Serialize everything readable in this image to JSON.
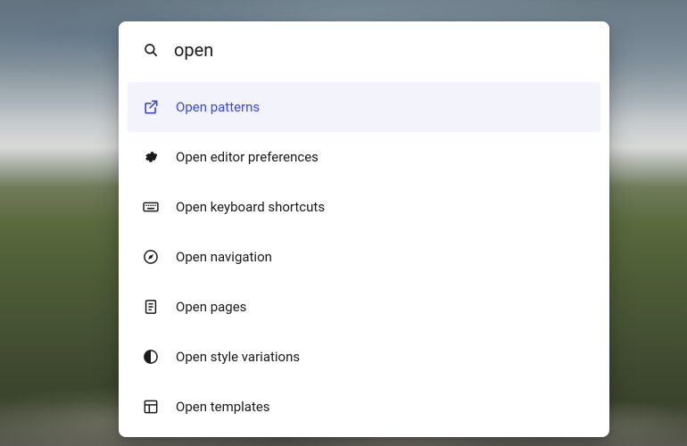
{
  "search": {
    "value": "open"
  },
  "results": [
    {
      "icon": "external-link-icon",
      "label": "Open patterns",
      "selected": true
    },
    {
      "icon": "gear-icon",
      "label": "Open editor preferences",
      "selected": false
    },
    {
      "icon": "keyboard-icon",
      "label": "Open keyboard shortcuts",
      "selected": false
    },
    {
      "icon": "compass-icon",
      "label": "Open navigation",
      "selected": false
    },
    {
      "icon": "page-icon",
      "label": "Open pages",
      "selected": false
    },
    {
      "icon": "half-circle-icon",
      "label": "Open style variations",
      "selected": false
    },
    {
      "icon": "layout-icon",
      "label": "Open templates",
      "selected": false
    }
  ]
}
